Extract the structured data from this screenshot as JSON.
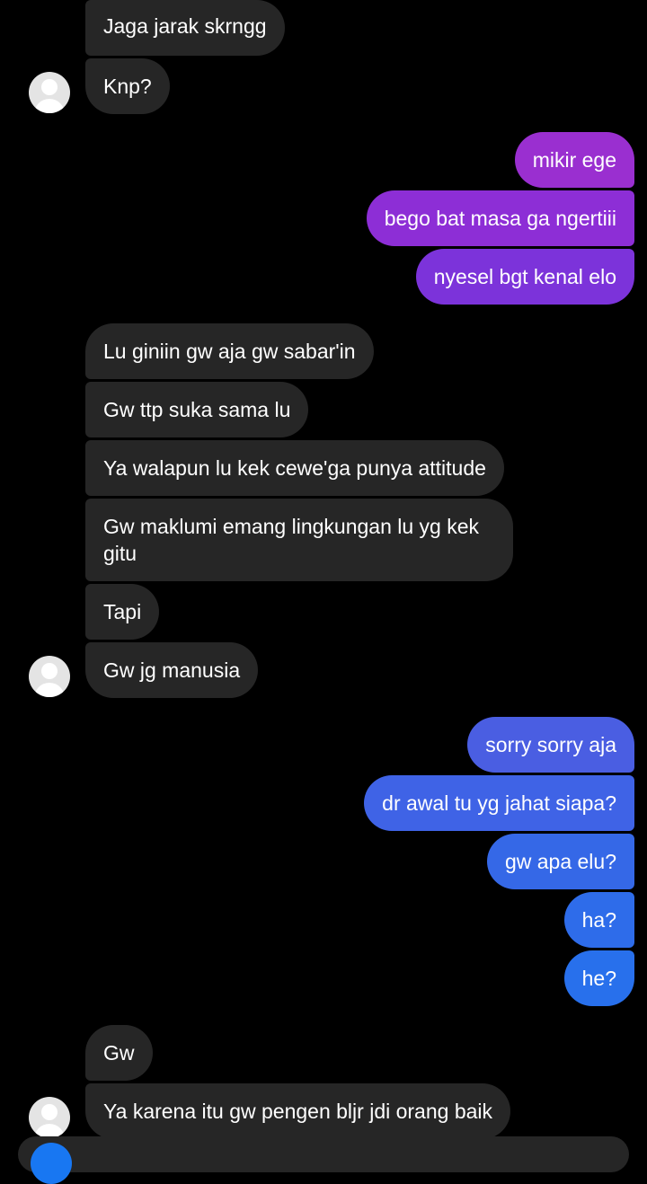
{
  "messages": [
    {
      "text": "Jaga jarak skrngg",
      "dir": "in"
    },
    {
      "text": "Knp?",
      "dir": "in"
    },
    {
      "text": "mikir ege",
      "dir": "out"
    },
    {
      "text": "bego bat masa ga ngertiii",
      "dir": "out"
    },
    {
      "text": "nyesel bgt kenal elo",
      "dir": "out"
    },
    {
      "text": "Lu giniin gw aja gw sabar'in",
      "dir": "in"
    },
    {
      "text": "Gw ttp suka sama lu",
      "dir": "in"
    },
    {
      "text": "Ya walapun lu kek cewe'ga punya attitude",
      "dir": "in"
    },
    {
      "text": "Gw maklumi emang lingkungan lu yg kek gitu",
      "dir": "in"
    },
    {
      "text": "Tapi",
      "dir": "in"
    },
    {
      "text": "Gw jg manusia",
      "dir": "in"
    },
    {
      "text": "sorry sorry aja",
      "dir": "out"
    },
    {
      "text": "dr awal tu yg jahat siapa?",
      "dir": "out"
    },
    {
      "text": "gw apa elu?",
      "dir": "out"
    },
    {
      "text": "ha?",
      "dir": "out"
    },
    {
      "text": "he?",
      "dir": "out"
    },
    {
      "text": "Gw",
      "dir": "in"
    },
    {
      "text": "Ya karena itu gw pengen bljr jdi orang baik",
      "dir": "in"
    }
  ],
  "colors": {
    "incoming": "#262626",
    "outgoing_purple_1": "#9a2fd0",
    "outgoing_purple_2": "#8d2ed6",
    "outgoing_purple_3": "#7c33da",
    "outgoing_blue_1": "#4a5ee2",
    "outgoing_blue_2": "#3f63e6",
    "outgoing_blue_3": "#3568e7",
    "outgoing_blue_4": "#2e6cea",
    "outgoing_blue_5": "#2870ec"
  },
  "icons": [
    "avatar-icon",
    "messenger-icon"
  ]
}
